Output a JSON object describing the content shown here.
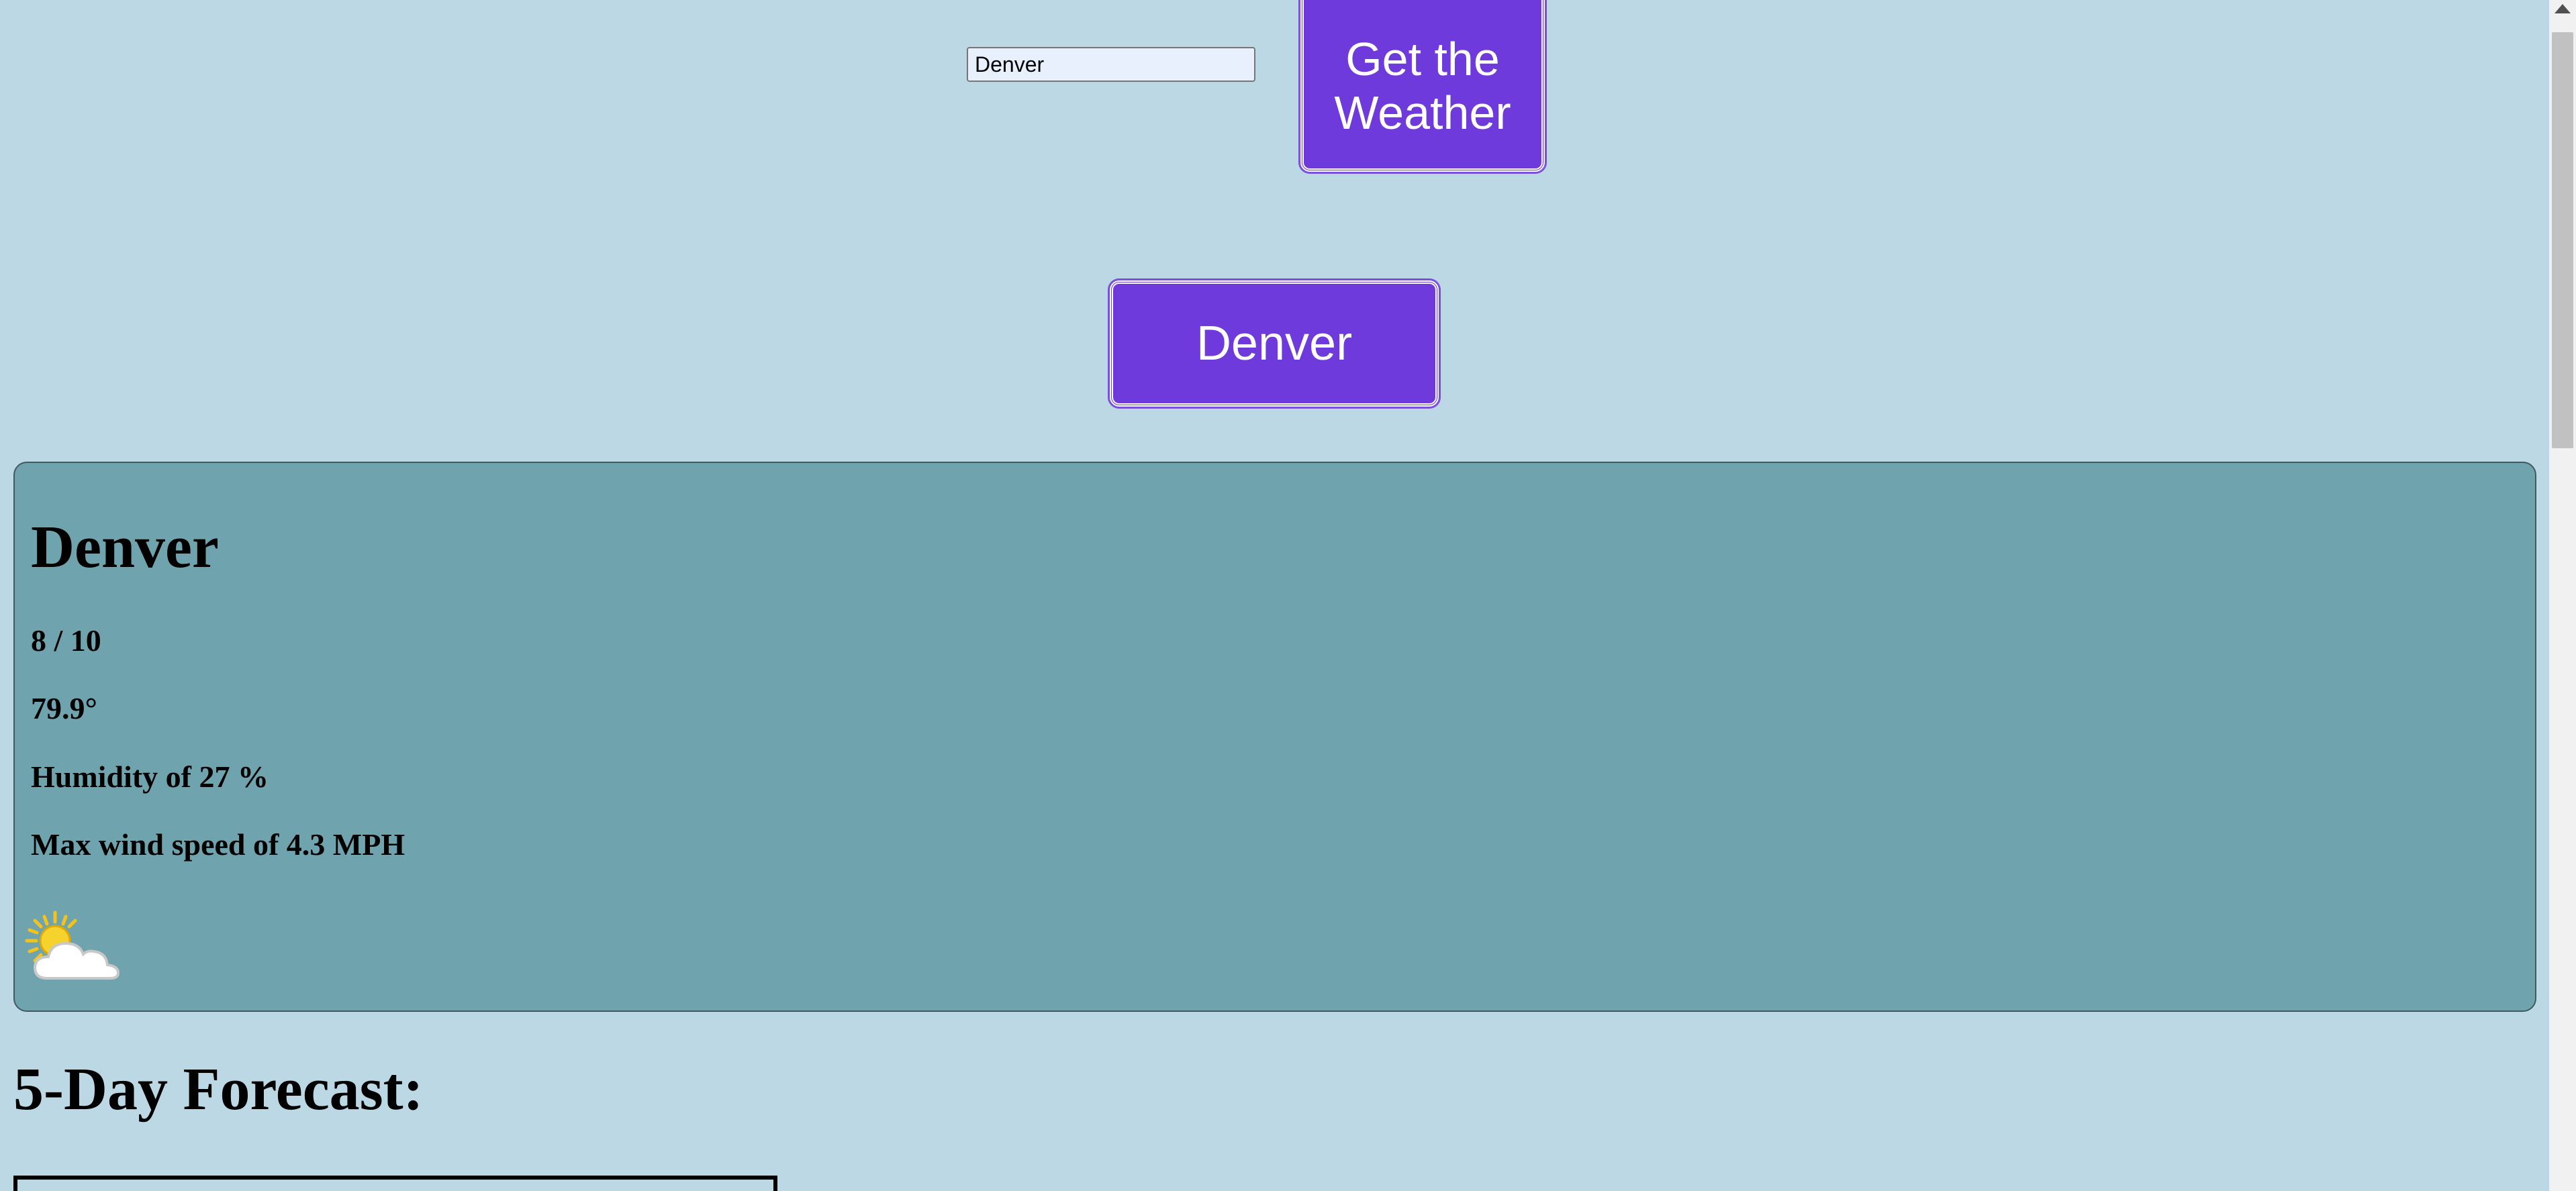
{
  "search": {
    "value": "Denver"
  },
  "buttons": {
    "get_weather_label": "Get the Weather",
    "city_label": "Denver"
  },
  "current": {
    "city": "Denver",
    "date": "8 / 10",
    "temperature": "79.9°",
    "humidity": "Humidity of 27 %",
    "wind": "Max wind speed of 4.3 MPH",
    "icon": "partly-cloudy-icon"
  },
  "forecast": {
    "title": "5-Day Forecast:"
  },
  "colors": {
    "background": "#bcd8e5",
    "button": "#6f3adb",
    "card": "#6fa4ae"
  }
}
